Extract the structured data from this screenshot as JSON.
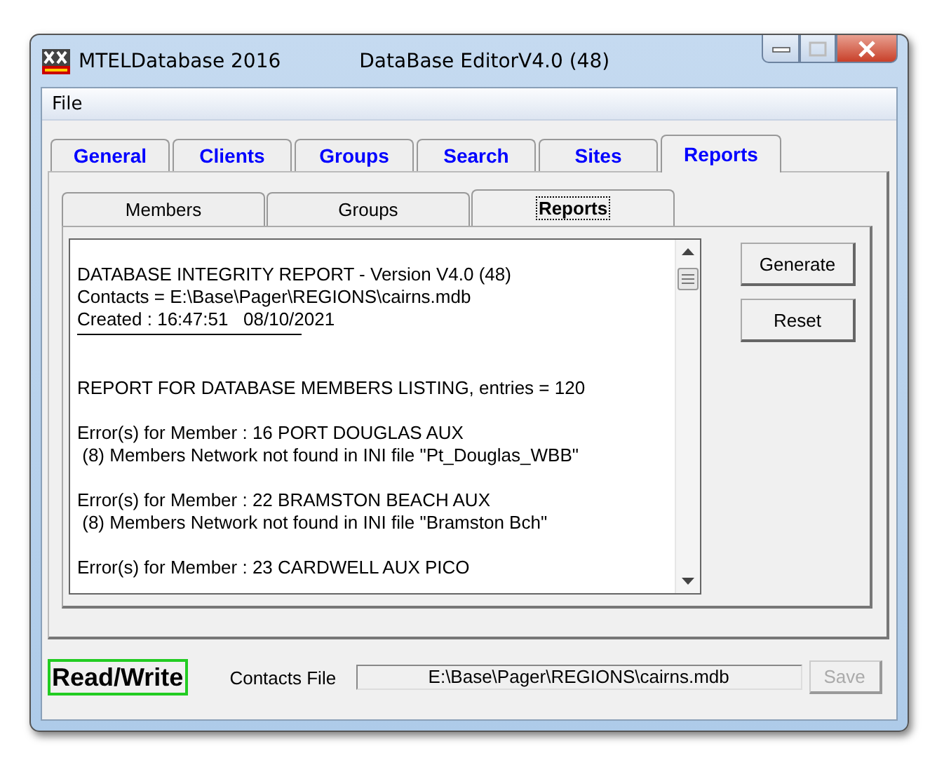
{
  "window": {
    "app_name": "MTELDatabase 2016",
    "title": "DataBase EditorV4.0 (48)"
  },
  "menu": [
    "File"
  ],
  "tabs": [
    {
      "label": "General",
      "selected": false
    },
    {
      "label": "Clients",
      "selected": false
    },
    {
      "label": "Groups",
      "selected": false
    },
    {
      "label": "Search",
      "selected": false
    },
    {
      "label": "Sites",
      "selected": false
    },
    {
      "label": "Reports",
      "selected": true
    }
  ],
  "subtabs": [
    {
      "label": "Members",
      "selected": false
    },
    {
      "label": "Groups",
      "selected": false
    },
    {
      "label": "Reports",
      "selected": true
    }
  ],
  "report": [
    {
      "kind": "text",
      "lines": [
        "DATABASE INTEGRITY REPORT - Version V4.0 (48)",
        "Contacts = E:\\Base\\Pager\\REGIONS\\cairns.mdb",
        "Created : 16:47:51   08/10/2021"
      ]
    },
    {
      "kind": "rule"
    },
    {
      "kind": "text",
      "lines": [
        "REPORT FOR DATABASE MEMBERS LISTING, entries = 120"
      ]
    },
    {
      "kind": "text",
      "lines": [
        "Error(s) for Member : 16 PORT DOUGLAS AUX",
        " (8) Members Network not found in INI file \"Pt_Douglas_WBB\""
      ]
    },
    {
      "kind": "text",
      "lines": [
        "Error(s) for Member : 22 BRAMSTON BEACH AUX",
        " (8) Members Network not found in INI file \"Bramston Bch\""
      ]
    },
    {
      "kind": "text",
      "lines": [
        "Error(s) for Member : 23 CARDWELL AUX PICO"
      ]
    }
  ],
  "buttons": [
    {
      "label": "Generate",
      "disabled": false
    },
    {
      "label": "Reset",
      "disabled": false
    }
  ],
  "status_bar": {
    "mode": "Read/Write",
    "file_label": "Contacts File",
    "file_value": "E:\\Base\\Pager\\REGIONS\\cairns.mdb",
    "save": {
      "label": "Save",
      "disabled": true
    }
  }
}
